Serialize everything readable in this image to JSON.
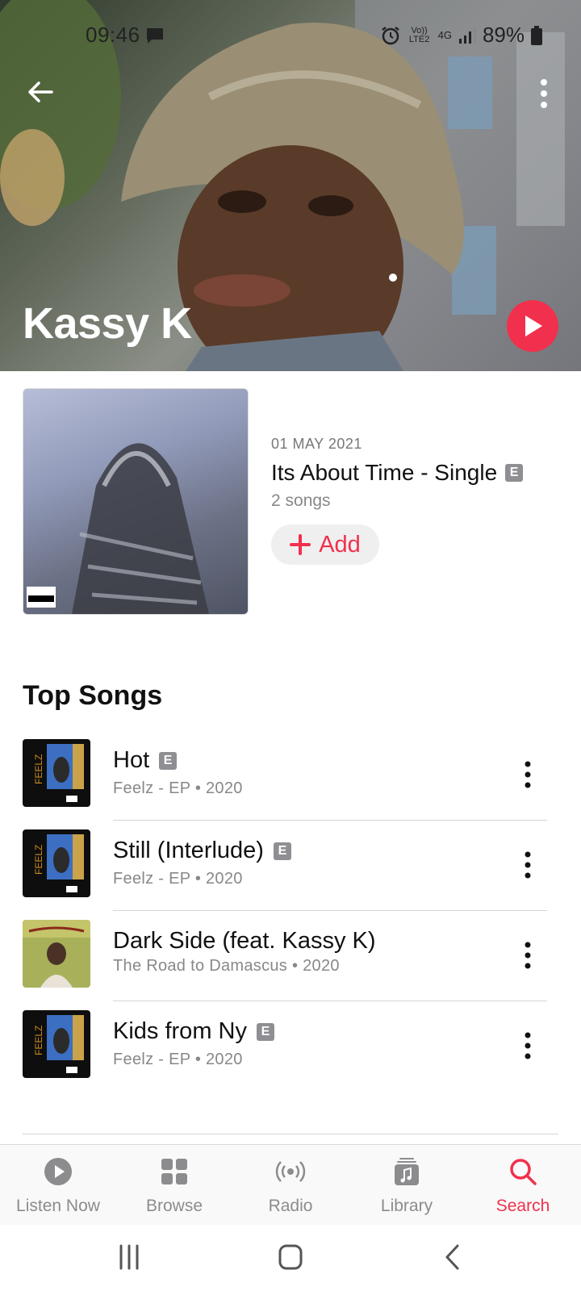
{
  "status_bar": {
    "time": "09:46",
    "battery_text": "89%",
    "network_label": "4G",
    "volte_label": "Vo)) LTE2"
  },
  "artist": {
    "name": "Kassy K"
  },
  "latest_release": {
    "date": "01 MAY 2021",
    "title": "Its About Time - Single",
    "explicit_badge": "E",
    "song_count": "2 songs",
    "add_label": "Add"
  },
  "top_songs": {
    "title": "Top Songs",
    "items": [
      {
        "title": "Hot",
        "explicit": "E",
        "subtitle": "Feelz - EP • 2020"
      },
      {
        "title": "Still (Interlude)",
        "explicit": "E",
        "subtitle": "Feelz - EP • 2020"
      },
      {
        "title": "Dark Side (feat. Kassy K)",
        "explicit": "",
        "subtitle": "The Road to Damascus • 2020"
      },
      {
        "title": "Kids from Ny",
        "explicit": "E",
        "subtitle": "Feelz - EP • 2020"
      }
    ]
  },
  "tabbar": {
    "tabs": [
      {
        "label": "Listen Now",
        "icon": "play-circle-icon"
      },
      {
        "label": "Browse",
        "icon": "grid-icon"
      },
      {
        "label": "Radio",
        "icon": "radio-icon"
      },
      {
        "label": "Library",
        "icon": "library-icon"
      },
      {
        "label": "Search",
        "icon": "search-icon"
      }
    ],
    "active": "Search"
  },
  "colors": {
    "accent": "#f1304d",
    "secondary_text": "#888888"
  }
}
